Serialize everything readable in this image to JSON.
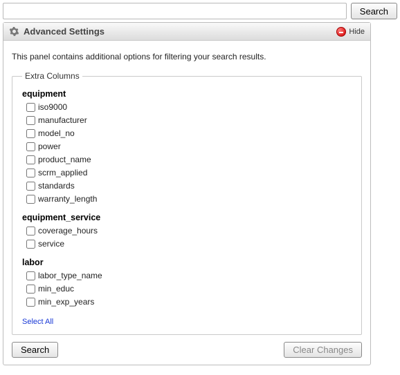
{
  "top": {
    "search_input_value": "",
    "search_input_placeholder": "",
    "search_btn": "Search"
  },
  "panel": {
    "title": "Advanced Settings",
    "hide_label": "Hide",
    "description": "This panel contains additional options for filtering your search results.",
    "fieldset_legend": "Extra Columns",
    "groups": [
      {
        "name": "equipment",
        "items": [
          "iso9000",
          "manufacturer",
          "model_no",
          "power",
          "product_name",
          "scrm_applied",
          "standards",
          "warranty_length"
        ]
      },
      {
        "name": "equipment_service",
        "items": [
          "coverage_hours",
          "service"
        ]
      },
      {
        "name": "labor",
        "items": [
          "labor_type_name",
          "min_educ",
          "min_exp_years"
        ]
      }
    ],
    "select_all": "Select All",
    "search_btn": "Search",
    "clear_btn": "Clear Changes"
  }
}
